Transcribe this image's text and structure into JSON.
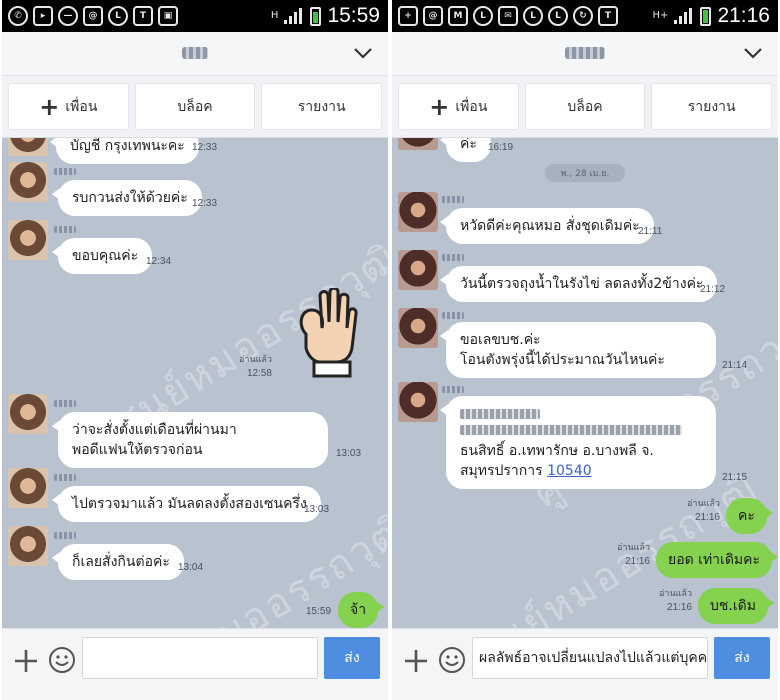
{
  "left": {
    "status_time": "15:59",
    "network": "H",
    "actions": {
      "add_friend": "เพื่อน",
      "block": "บล็อค",
      "report": "รายงาน"
    },
    "messages": [
      {
        "text": "บัญชี กรุงเทพนะคะ",
        "time": "12:33"
      },
      {
        "text": "รบกวนส่งให้ด้วยค่ะ",
        "time": "12:33"
      },
      {
        "text": "ขอบคุณค่ะ",
        "time": "12:34"
      },
      {
        "read": "อ่านแล้ว",
        "time": "12:58"
      },
      {
        "line1": "ว่าจะสั่งตั้งแต่เดือนที่ผ่านมา",
        "line2": "พอดีแฟนให้ตรวจก่อน",
        "time": "13:03"
      },
      {
        "text": "ไปตรวจมาแล้ว มันลดลงตั้งสองเซนครึ่ง",
        "time": "13:03"
      },
      {
        "text": "ก็เลยสั่งกินต่อค่ะ",
        "time": "13:04"
      },
      {
        "text": "จ้า",
        "time": "15:59"
      }
    ],
    "watermark": "ศูนย์หมออรรถวุฒิ",
    "input_value": "",
    "send_label": "ส่ง"
  },
  "right": {
    "status_time": "21:16",
    "network": "H+",
    "actions": {
      "add_friend": "เพื่อน",
      "block": "บล็อค",
      "report": "รายงาน"
    },
    "date_divider": "พ., 28 เม.ย.",
    "messages": [
      {
        "text": "ค่ะ",
        "time": "16:19"
      },
      {
        "text": "หวัดดีค่ะคุณหมอ สั่งชุดเดิมค่ะ",
        "time": "21:11"
      },
      {
        "text": "วันนี้ตรวจถุงน้ำในรังไข่  ลดลงทั้ง2ข้างค่ะ",
        "time": "21:12"
      },
      {
        "line1": "ขอเลขบช.ค่ะ",
        "line2": "โอนตังพรุ่งนี้ได้ประมาณวันไหนค่ะ",
        "time": "21:14"
      },
      {
        "line3": "ธนสิทธิ์ อ.เทพารักษ อ.บางพลี จ.",
        "line4": "สมุทรปราการ ",
        "postcode": "10540",
        "time": "21:15"
      },
      {
        "read": "อ่านแล้ว",
        "text": "คะ",
        "time": "21:16"
      },
      {
        "read": "อ่านแล้ว",
        "text": "ยอด เท่าเดิมคะ",
        "time": "21:16"
      },
      {
        "read": "อ่านแล้ว",
        "text": "บช.เดิม",
        "time": "21:16"
      }
    ],
    "watermark": "ศูนย์หมออรรถวุฒิ",
    "input_value": "ผลลัพธ์อาจเปลี่ยนแปลงไปแล้วแต่บุคคล",
    "send_label": "ส่ง"
  },
  "colors": {
    "sent_bubble": "#84d24e",
    "send_button": "#4f8de0",
    "chat_bg": "#b9c2cf"
  },
  "icons": [
    "whatsapp-icon",
    "app-icon",
    "minus-circle-icon",
    "at-icon",
    "line-icon",
    "t-icon",
    "clipboard-icon",
    "plus-icon",
    "smiley-icon",
    "chevron-down-icon",
    "ok-hand-icon"
  ]
}
